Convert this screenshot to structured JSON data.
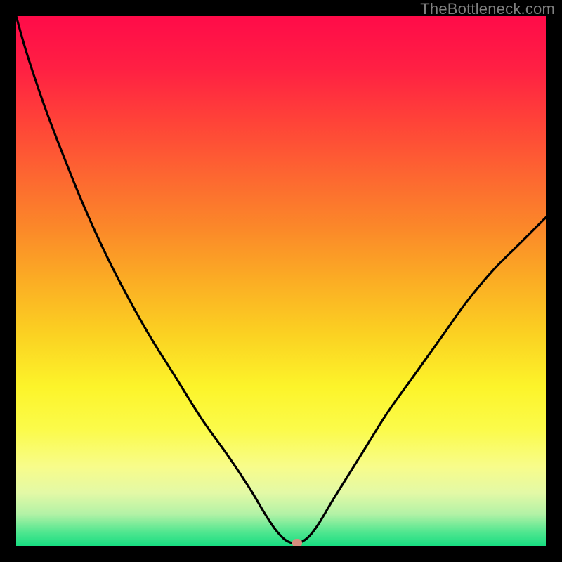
{
  "branding": {
    "watermark": "TheBottleneck.com"
  },
  "chart_data": {
    "type": "line",
    "title": "",
    "xlabel": "",
    "ylabel": "",
    "xlim": [
      0,
      100
    ],
    "ylim": [
      0,
      100
    ],
    "grid": false,
    "legend": false,
    "series": [
      {
        "name": "bottleneck-curve",
        "x": [
          0,
          2,
          5,
          8,
          12,
          16,
          20,
          25,
          30,
          35,
          40,
          44,
          47,
          49,
          51,
          53,
          55,
          57,
          60,
          65,
          70,
          75,
          80,
          85,
          90,
          95,
          100
        ],
        "y": [
          100,
          93,
          84,
          76,
          66,
          57,
          49,
          40,
          32,
          24,
          17,
          11,
          6,
          3,
          1,
          0.5,
          1.5,
          4,
          9,
          17,
          25,
          32,
          39,
          46,
          52,
          57,
          62
        ]
      }
    ],
    "marker": {
      "x": 53,
      "y": 0.5,
      "color": "#d58d7e"
    },
    "background_gradient": {
      "stops": [
        {
          "pos": 0.0,
          "color": "#ff0b49"
        },
        {
          "pos": 0.1,
          "color": "#ff2043"
        },
        {
          "pos": 0.2,
          "color": "#ff4338"
        },
        {
          "pos": 0.3,
          "color": "#fd6631"
        },
        {
          "pos": 0.4,
          "color": "#fb8829"
        },
        {
          "pos": 0.5,
          "color": "#fbad24"
        },
        {
          "pos": 0.6,
          "color": "#fbd122"
        },
        {
          "pos": 0.7,
          "color": "#fcf42a"
        },
        {
          "pos": 0.78,
          "color": "#fbfb4a"
        },
        {
          "pos": 0.85,
          "color": "#f8fc8a"
        },
        {
          "pos": 0.9,
          "color": "#e3f9a6"
        },
        {
          "pos": 0.94,
          "color": "#b3f2a6"
        },
        {
          "pos": 0.975,
          "color": "#4ee68f"
        },
        {
          "pos": 1.0,
          "color": "#18dd81"
        }
      ]
    }
  }
}
